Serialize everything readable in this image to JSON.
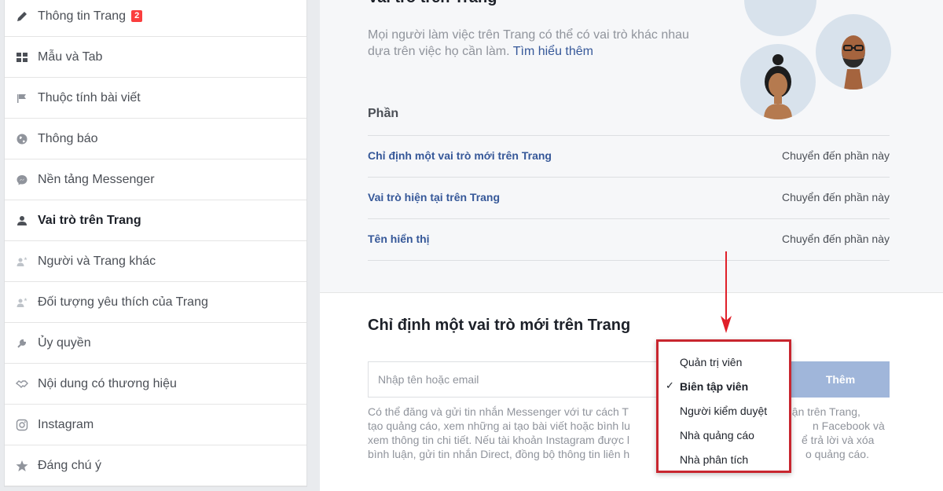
{
  "sidebar": {
    "items": [
      {
        "label": "Thông tin Trang",
        "icon": "pencil-icon",
        "badge": "2"
      },
      {
        "label": "Mẫu và Tab",
        "icon": "grid-icon"
      },
      {
        "label": "Thuộc tính bài viết",
        "icon": "flag-icon"
      },
      {
        "label": "Thông báo",
        "icon": "globe-icon"
      },
      {
        "label": "Nền tảng Messenger",
        "icon": "messenger-icon"
      },
      {
        "label": "Vai trò trên Trang",
        "icon": "person-icon",
        "active": true
      },
      {
        "label": "Người và Trang khác",
        "icon": "people-star-icon"
      },
      {
        "label": "Đối tượng yêu thích của Trang",
        "icon": "people-star-icon"
      },
      {
        "label": "Ủy quyền",
        "icon": "wrench-icon"
      },
      {
        "label": "Nội dung có thương hiệu",
        "icon": "handshake-icon"
      },
      {
        "label": "Instagram",
        "icon": "instagram-icon"
      },
      {
        "label": "Đáng chú ý",
        "icon": "star-icon"
      }
    ]
  },
  "roles_section": {
    "title": "Vai trò trên Trang",
    "description": "Mọi người làm việc trên Trang có thể có vai trò khác nhau dựa trên việc họ cần làm.",
    "learn_more": "Tìm hiểu thêm",
    "sections_label": "Phần",
    "rows": [
      {
        "label": "Chỉ định một vai trò mới trên Trang",
        "action": "Chuyển đến phần này"
      },
      {
        "label": "Vai trò hiện tại trên Trang",
        "action": "Chuyển đến phần này"
      },
      {
        "label": "Tên hiển thị",
        "action": "Chuyển đến phần này"
      }
    ]
  },
  "assign_section": {
    "title": "Chỉ định một vai trò mới trên Trang",
    "input_placeholder": "Nhập tên hoặc email",
    "add_button": "Thêm",
    "info_lines": [
      "Có thể đăng và gửi tin nhắn Messenger với tư cách T",
      "tạo quảng cáo, xem những ai tạo bài viết hoặc bình lu",
      "xem thông tin chi tiết. Nếu tài khoản Instagram được l",
      "bình luận, gửi tin nhắn Direct, đồng bộ thông tin liên h"
    ],
    "info_tail_lines": [
      "uận trên Trang,",
      "n Facebook và",
      "ể trả lời và xóa",
      "o quảng cáo."
    ]
  },
  "role_dropdown": {
    "options": [
      "Quản trị viên",
      "Biên tập viên",
      "Người kiểm duyệt",
      "Nhà quảng cáo",
      "Nhà phân tích"
    ],
    "selected": "Biên tập viên",
    "check_mark": "✓"
  },
  "colors": {
    "link": "#365899",
    "highlight_border": "#c8262f",
    "annotation_arrow": "#e0202a",
    "badge": "#fa3e3e",
    "add_button": "#a0b6da"
  }
}
